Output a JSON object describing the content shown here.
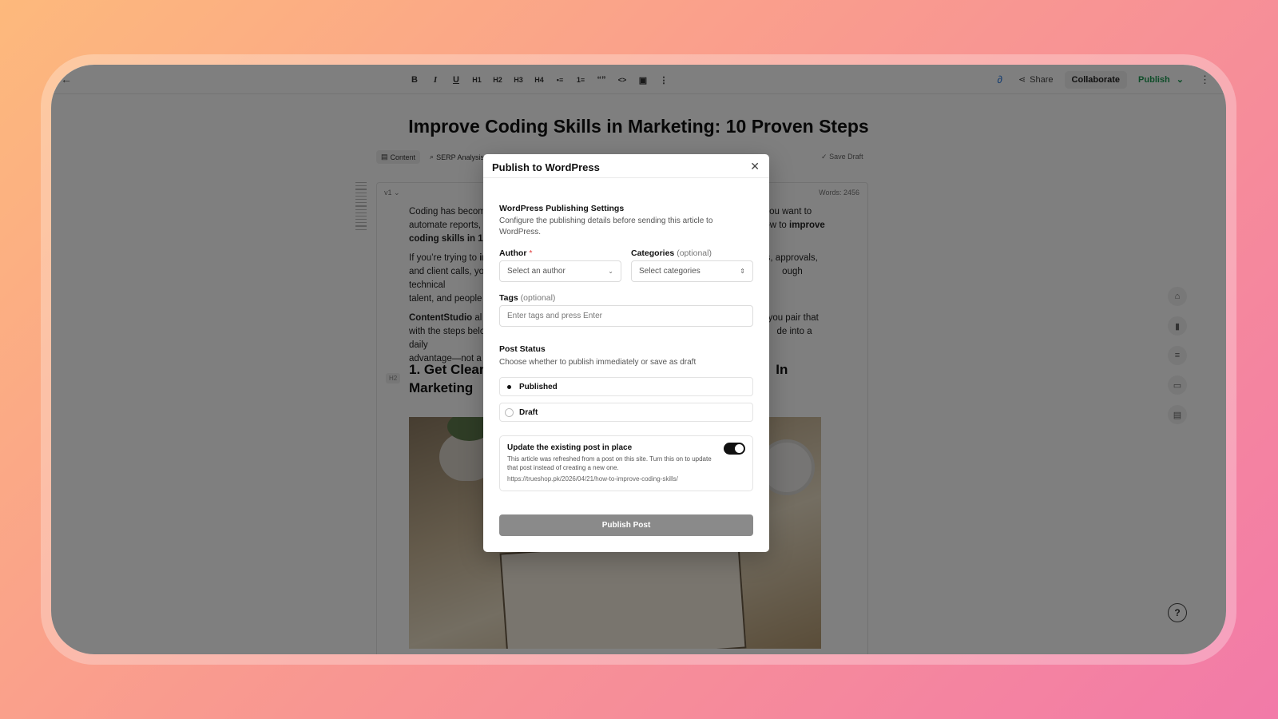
{
  "toolbar": {
    "format_buttons": [
      "B",
      "I",
      "U",
      "H1",
      "H2",
      "H3",
      "H4",
      "•≡",
      "1≡",
      "“”",
      "<>",
      "▣",
      "⋮"
    ],
    "share_label": "Share",
    "collaborate_label": "Collaborate",
    "publish_label": "Publish"
  },
  "article": {
    "title": "Improve Coding Skills in Marketing: 10 Proven Steps",
    "tabs": [
      "Content",
      "SERP Analysis"
    ],
    "save_draft": "Save Draft",
    "version": "v1",
    "words": "Words: 2456",
    "h2_badge": "H2",
    "p1a": "Coding has becom",
    "p1b": "ou want to",
    "p1c": "automate reports,",
    "p1d": "ow to",
    "p1e": "improve",
    "p1f": "coding skills in 1",
    "p2a": "If you’re trying to",
    "p2b": "in",
    "p2c": "s, approvals,",
    "p2d": "and client calls, yo",
    "p2e": "ough technical",
    "p2f": "talent, and people",
    "p3a": "ContentStudio",
    "p3b": "al",
    "p3c": "you pair that",
    "p3d": "with the steps belo",
    "p3e": "de into a daily",
    "p3f": "advantage—not a",
    "h2a": "1. Get Clear",
    "h2b": "In",
    "h2c": "Marketing"
  },
  "modal": {
    "title": "Publish to WordPress",
    "section_title": "WordPress Publishing Settings",
    "section_desc": "Configure the publishing details before sending this article to WordPress.",
    "author_label": "Author",
    "author_required": "*",
    "author_placeholder": "Select an author",
    "categories_label": "Categories",
    "categories_optional": "(optional)",
    "categories_placeholder": "Select categories",
    "tags_label": "Tags",
    "tags_optional": "(optional)",
    "tags_placeholder": "Enter tags and press Enter",
    "post_status_title": "Post Status",
    "post_status_desc": "Choose whether to publish immediately or save as draft",
    "status_options": [
      "Published",
      "Draft"
    ],
    "selected_status": "Published",
    "update_title": "Update the existing post in place",
    "update_desc": "This article was refreshed from a post on this site. Turn this on to update that post instead of creating a new one.",
    "update_url": "https://trueshop.pk/2026/04/21/how-to-improve-coding-skills/",
    "update_enabled": true,
    "publish_button": "Publish Post"
  },
  "colors": {
    "accent_publish": "#1d9a53",
    "required": "#e03a3a",
    "publish_button_bg": "#8a8a8a"
  }
}
